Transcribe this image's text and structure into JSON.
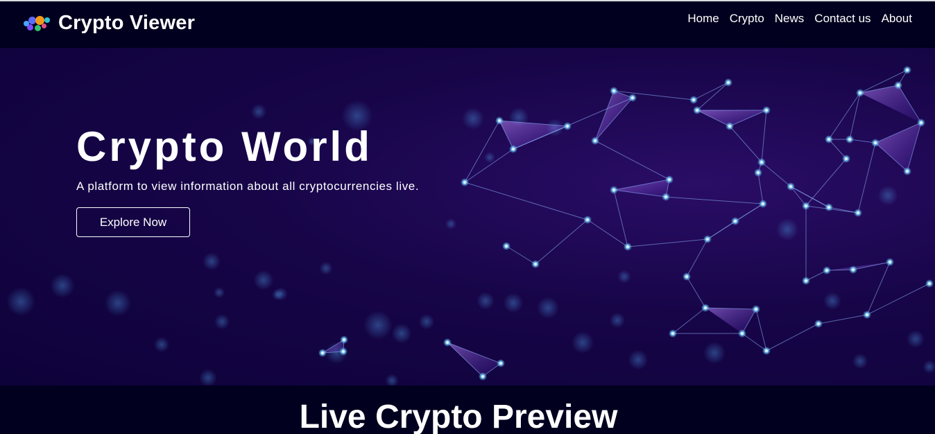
{
  "brand": {
    "title": "Crypto Viewer",
    "logo_icon": "crypto-coins-logo-icon"
  },
  "nav": {
    "items": [
      {
        "label": "Home"
      },
      {
        "label": "Crypto"
      },
      {
        "label": "News"
      },
      {
        "label": "Contact us"
      },
      {
        "label": "About"
      }
    ]
  },
  "hero": {
    "title": "Crypto World",
    "subtitle": "A platform to view information about all cryptocurrencies live.",
    "button_label": "Explore Now",
    "background": "network-plexus-background"
  },
  "preview": {
    "title": "Live Crypto Preview"
  },
  "colors": {
    "navbar_bg": "#01001f",
    "hero_bg": "#170548",
    "accent_node": "#5ec8ff",
    "accent_line": "#8a5ce0",
    "text": "#ffffff"
  }
}
